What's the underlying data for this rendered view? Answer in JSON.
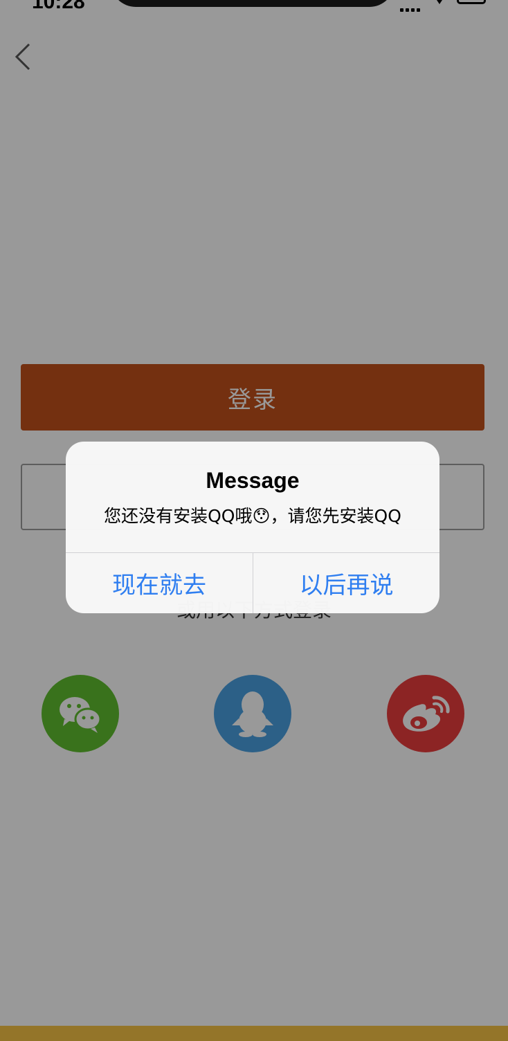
{
  "status_bar": {
    "time": "10:28"
  },
  "login": {
    "button_label": "登录"
  },
  "other_login": {
    "label": "或用以下方式登录"
  },
  "social": [
    "wechat-icon",
    "qq-icon",
    "weibo-icon"
  ],
  "colors": {
    "login_button": "#c2501c",
    "wechat": "#5fbf2f",
    "qq": "#4aa1e2",
    "weibo": "#ea3c3c",
    "alert_action": "#2f7ef0"
  },
  "alert": {
    "title": "Message",
    "message": "您还没有安装QQ哦😯，请您先安装QQ",
    "confirm_label": "现在就去",
    "cancel_label": "以后再说"
  }
}
